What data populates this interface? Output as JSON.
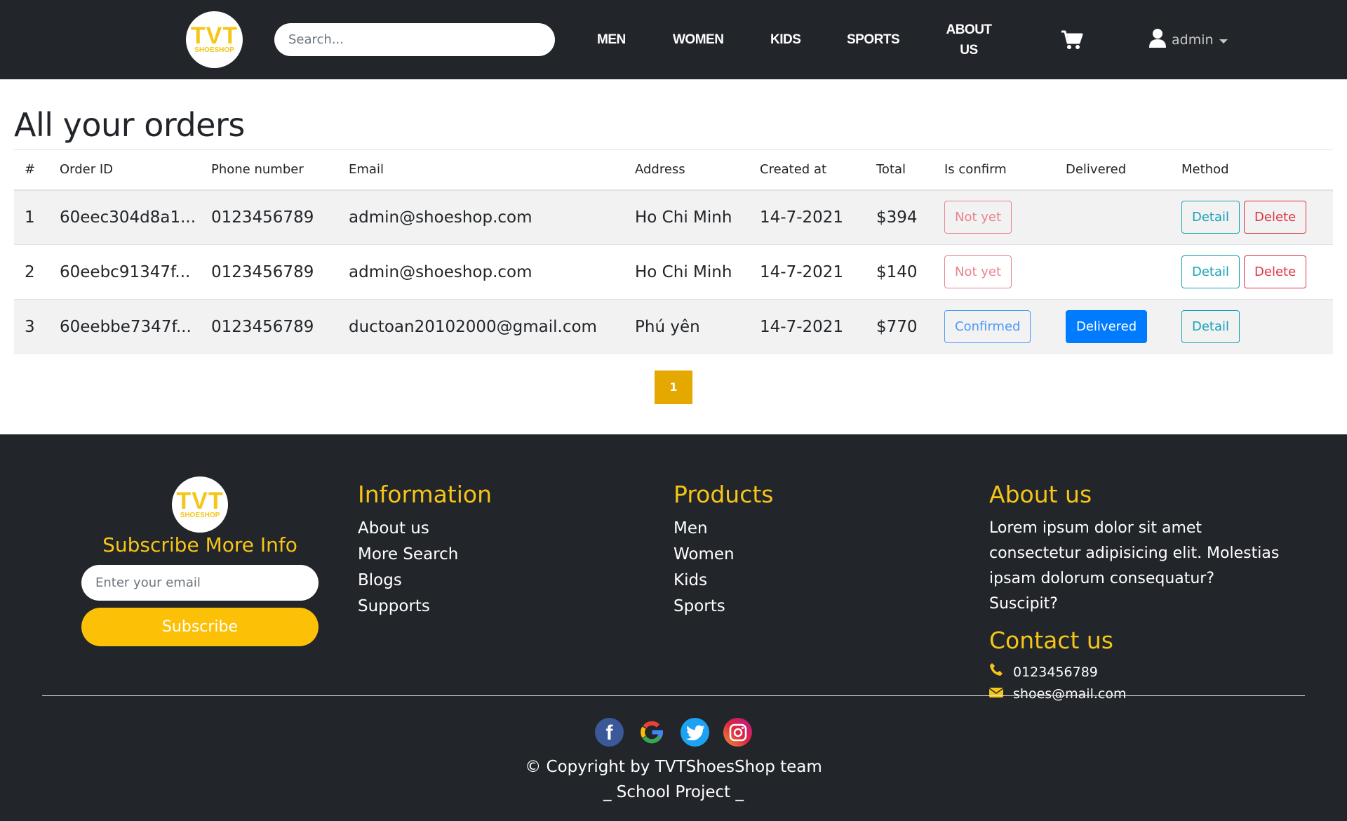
{
  "header": {
    "logo": {
      "main": "TVT",
      "sub": "SHOESHOP"
    },
    "search_placeholder": "Search...",
    "nav": {
      "men": "MEN",
      "women": "WOMEN",
      "kids": "KIDS",
      "sports": "SPORTS",
      "about_line1": "ABOUT",
      "about_line2": "US"
    },
    "cart_icon": "cart-icon",
    "user": {
      "icon": "user-icon",
      "name": "admin"
    }
  },
  "main": {
    "title": "All your orders",
    "table": {
      "headers": [
        "#",
        "Order ID",
        "Phone number",
        "Email",
        "Address",
        "Created at",
        "Total",
        "Is confirm",
        "Delivered",
        "Method"
      ],
      "rows": [
        {
          "num": "1",
          "order_id": "60eec304d8a1...",
          "phone": "0123456789",
          "email": "admin@shoeshop.com",
          "address": "Ho Chi Minh",
          "created": "14-7-2021",
          "total": "$394",
          "confirm": "Not yet",
          "delivered": "",
          "detail": "Detail",
          "delete": "Delete"
        },
        {
          "num": "2",
          "order_id": "60eebc91347f...",
          "phone": "0123456789",
          "email": "admin@shoeshop.com",
          "address": "Ho Chi Minh",
          "created": "14-7-2021",
          "total": "$140",
          "confirm": "Not yet",
          "delivered": "",
          "detail": "Detail",
          "delete": "Delete"
        },
        {
          "num": "3",
          "order_id": "60eebbe7347f...",
          "phone": "0123456789",
          "email": "ductoan20102000@gmail.com",
          "address": "Phú yên",
          "created": "14-7-2021",
          "total": "$770",
          "confirm": "Confirmed",
          "delivered": "Delivered",
          "detail": "Detail",
          "delete": ""
        }
      ]
    },
    "pagination": {
      "current": "1"
    }
  },
  "footer": {
    "logo": {
      "main": "TVT",
      "sub": "SHOESHOP"
    },
    "subscribe_title": "Subscribe More Info",
    "email_placeholder": "Enter your email",
    "subscribe_button": "Subscribe",
    "information": {
      "title": "Information",
      "items": [
        "About us",
        "More Search",
        "Blogs",
        "Supports"
      ]
    },
    "products": {
      "title": "Products",
      "items": [
        "Men",
        "Women",
        "Kids",
        "Sports"
      ]
    },
    "about": {
      "title": "About us",
      "text": "Lorem ipsum dolor sit amet consectetur adipisicing elit. Molestias ipsam dolorum consequatur? Suscipit?"
    },
    "contact": {
      "title": "Contact us",
      "phone": "0123456789",
      "email": "shoes@mail.com"
    },
    "socials": [
      "facebook-icon",
      "google-icon",
      "twitter-icon",
      "instagram-icon"
    ],
    "copyright_line1": "© Copyright by TVTShoesShop team",
    "copyright_line2": "_ School Project _"
  },
  "colors": {
    "navbar": "#22252a",
    "accent": "#f5c518",
    "pagination": "#e5a800",
    "primary": "#007bff",
    "danger": "#dc3545",
    "info": "#17a2b8"
  }
}
